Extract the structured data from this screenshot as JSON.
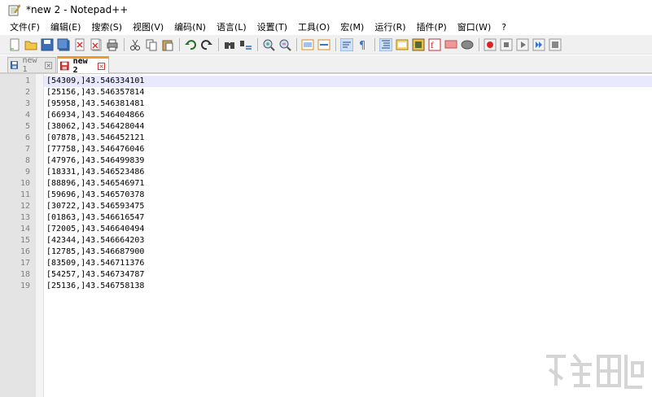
{
  "window": {
    "title": "*new 2 - Notepad++"
  },
  "menu": [
    "文件(F)",
    "编辑(E)",
    "搜索(S)",
    "视图(V)",
    "编码(N)",
    "语言(L)",
    "设置(T)",
    "工具(O)",
    "宏(M)",
    "运行(R)",
    "插件(P)",
    "窗口(W)",
    "?"
  ],
  "toolbar": {
    "groups": [
      [
        "new-file-icon",
        "open-file-icon",
        "save-icon",
        "save-all-icon",
        "close-icon",
        "close-all-icon",
        "print-icon"
      ],
      [
        "cut-icon",
        "copy-icon",
        "paste-icon"
      ],
      [
        "undo-icon",
        "redo-icon"
      ],
      [
        "find-icon",
        "replace-icon"
      ],
      [
        "zoom-in-icon",
        "zoom-out-icon"
      ],
      [
        "sync-vertical-icon",
        "sync-horizontal-icon"
      ],
      [
        "word-wrap-icon",
        "show-all-chars-icon"
      ],
      [
        "indent-guide-icon",
        "doc-map-icon",
        "folder-as-workspace-icon",
        "function-list-icon",
        "monitor-icon",
        "panel-icon"
      ],
      [
        "record-macro-icon",
        "stop-record-icon",
        "play-macro-icon",
        "run-macro-multiple-icon",
        "save-macro-icon"
      ]
    ]
  },
  "tabs": [
    {
      "label": "new 1",
      "active": false
    },
    {
      "label": "new 2",
      "active": true
    }
  ],
  "editor": {
    "lines": [
      {
        "num": "1",
        "text": "[54309,]43.546334101"
      },
      {
        "num": "2",
        "text": "[25156,]43.546357814"
      },
      {
        "num": "3",
        "text": "[95958,]43.546381481"
      },
      {
        "num": "4",
        "text": "[66934,]43.546404866"
      },
      {
        "num": "5",
        "text": "[38062,]43.546428044"
      },
      {
        "num": "6",
        "text": "[07878,]43.546452121"
      },
      {
        "num": "7",
        "text": "[77758,]43.546476046"
      },
      {
        "num": "8",
        "text": "[47976,]43.546499839"
      },
      {
        "num": "9",
        "text": "[18331,]43.546523486"
      },
      {
        "num": "10",
        "text": "[88896,]43.546546971"
      },
      {
        "num": "11",
        "text": "[59696,]43.546570378"
      },
      {
        "num": "12",
        "text": "[30722,]43.546593475"
      },
      {
        "num": "13",
        "text": "[01863,]43.546616547"
      },
      {
        "num": "14",
        "text": "[72005,]43.546640494"
      },
      {
        "num": "15",
        "text": "[42344,]43.546664203"
      },
      {
        "num": "16",
        "text": "[12785,]43.546687900"
      },
      {
        "num": "17",
        "text": "[83509,]43.546711376"
      },
      {
        "num": "18",
        "text": "[54257,]43.546734787"
      },
      {
        "num": "19",
        "text": "[25136,]43.546758138"
      }
    ]
  },
  "colors": {
    "active_tab_accent": "#f29b23",
    "current_line": "#e8e8ff",
    "gutter": "#e4e4e4"
  }
}
